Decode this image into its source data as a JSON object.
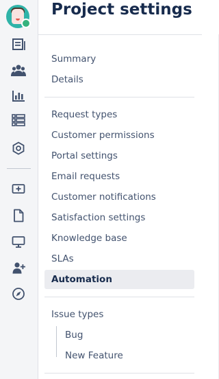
{
  "page": {
    "title": "Project settings"
  },
  "rail": {
    "icons": [
      "project-avatar",
      "queues-icon",
      "customers-icon",
      "reports-icon",
      "knowledge-icon",
      "settings-hexagon-icon",
      "add-item-icon",
      "pages-icon",
      "monitor-icon",
      "add-user-icon",
      "compass-icon"
    ]
  },
  "nav": {
    "general": [
      "Summary",
      "Details"
    ],
    "service": [
      "Request types",
      "Customer permissions",
      "Portal settings",
      "Email requests",
      "Customer notifications",
      "Satisfaction settings",
      "Knowledge base",
      "SLAs",
      "Automation"
    ],
    "active": "Automation",
    "issue_types": {
      "label": "Issue types",
      "children": [
        "Bug",
        "New Feature"
      ]
    }
  },
  "colors": {
    "rail_bg": "#f4f5f7",
    "text": "#172b4d",
    "muted_text": "#42526e",
    "active_bg": "#ebecf0",
    "avatar_bg": "#2fb3a8",
    "badge": "#36b37e"
  }
}
